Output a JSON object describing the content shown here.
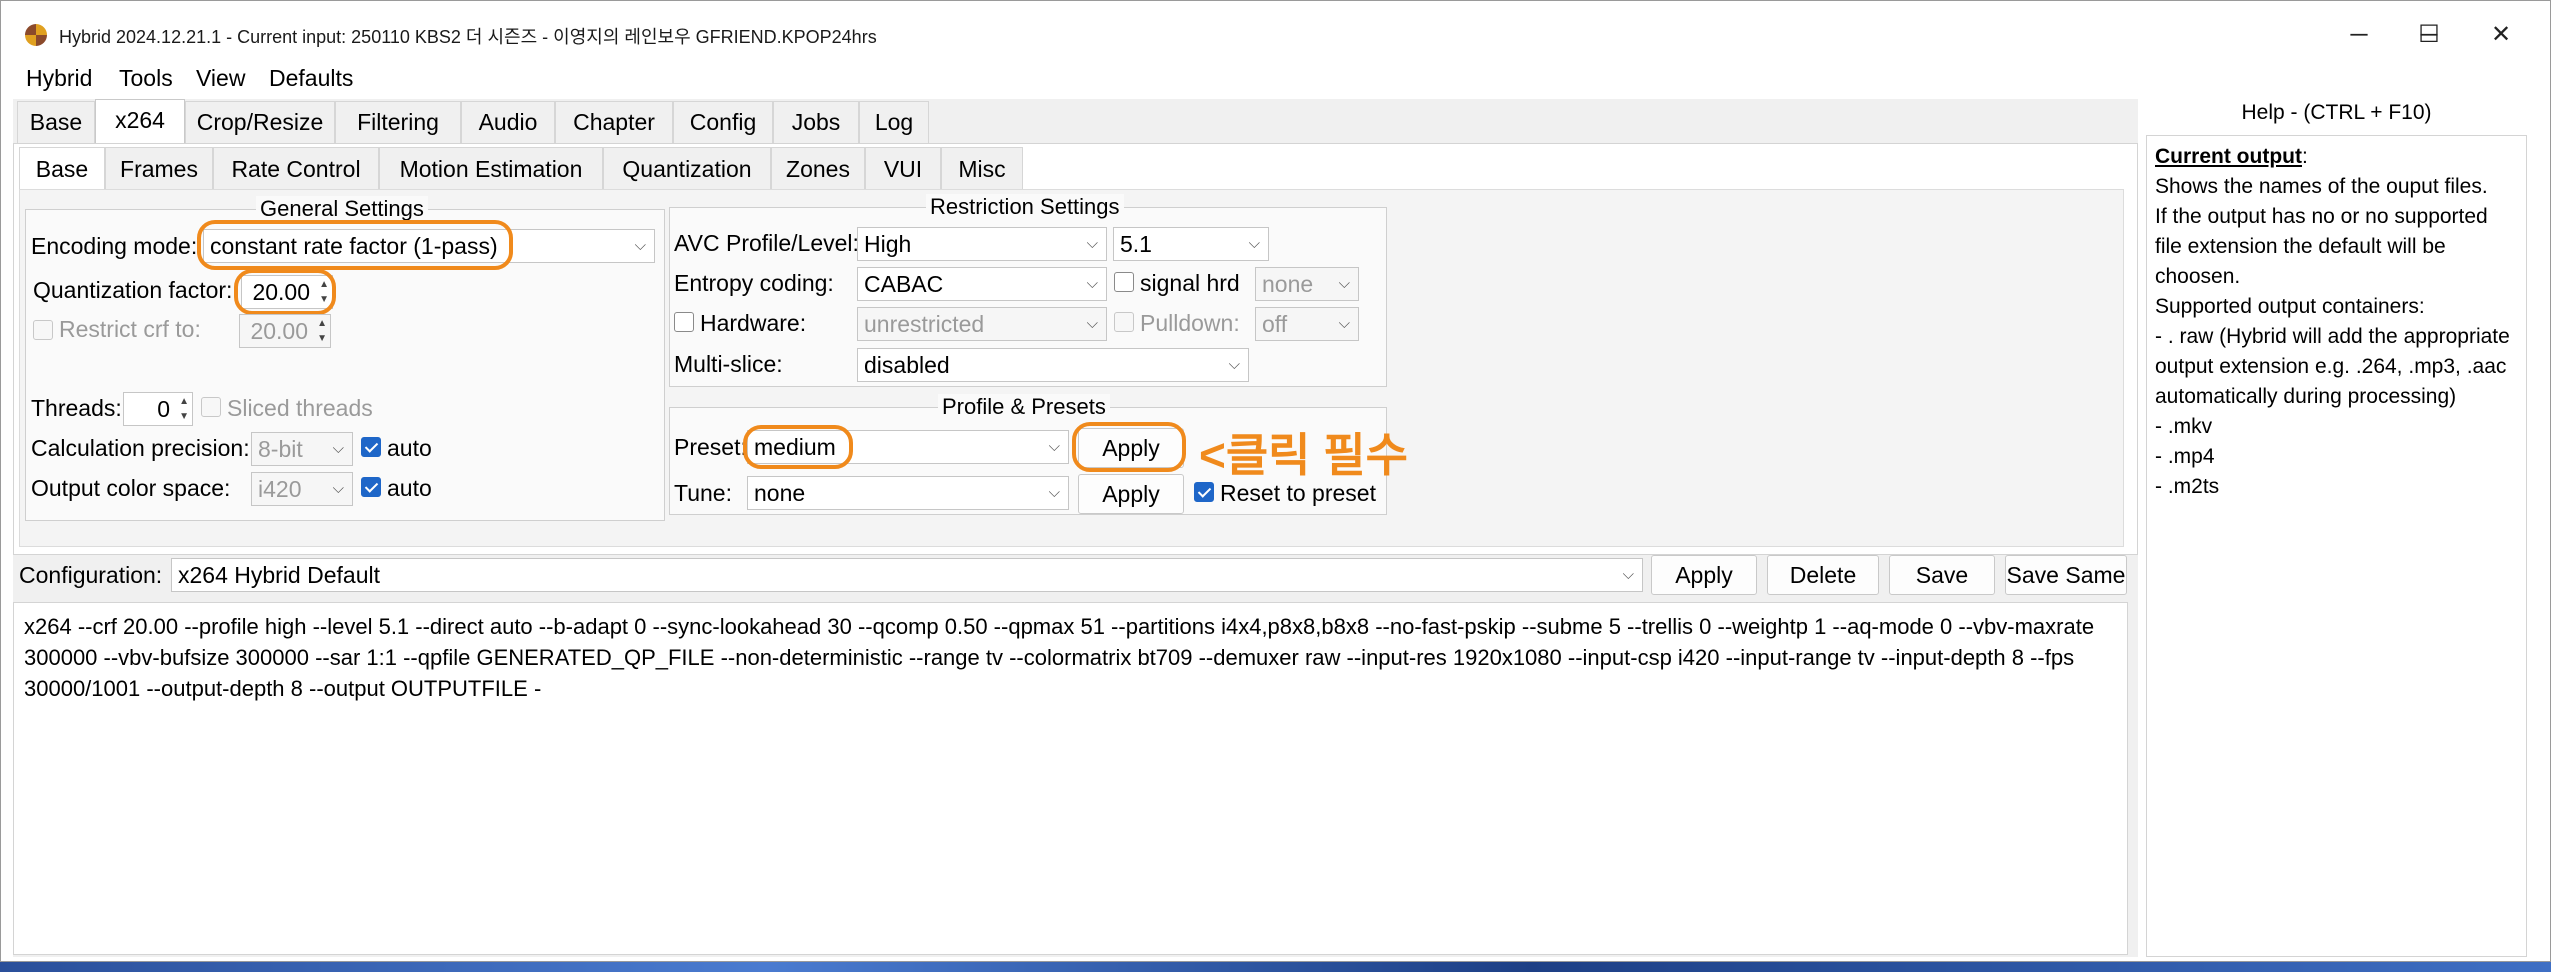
{
  "window": {
    "title": "Hybrid 2024.12.21.1 - Current input: 250110 KBS2 더 시즌즈 - 이영지의 레인보우 GFRIEND.KPOP24hrs",
    "minimize_glyph": "─",
    "maximize_glyph": "☐",
    "close_glyph": "✕"
  },
  "menubar": [
    "Hybrid",
    "Tools",
    "View",
    "Defaults"
  ],
  "main_tabs": [
    "Base",
    "x264",
    "Crop/Resize",
    "Filtering",
    "Audio",
    "Chapter",
    "Config",
    "Jobs",
    "Log"
  ],
  "sub_tabs": [
    "Base",
    "Frames",
    "Rate Control",
    "Motion Estimation",
    "Quantization",
    "Zones",
    "VUI",
    "Misc"
  ],
  "general": {
    "title": "General Settings",
    "encoding_mode_label": "Encoding mode:",
    "encoding_mode_value": "constant rate factor (1-pass)",
    "quant_label": "Quantization factor:",
    "quant_value": "20.00",
    "restrict_label": "Restrict crf to:",
    "restrict_value": "20.00",
    "threads_label": "Threads:",
    "threads_value": "0",
    "sliced_label": "Sliced threads",
    "calc_label": "Calculation precision:",
    "calc_value": "8-bit",
    "calc_auto": "auto",
    "colorspace_label": "Output color space:",
    "colorspace_value": "i420",
    "colorspace_auto": "auto"
  },
  "restriction": {
    "title": "Restriction Settings",
    "avc_label": "AVC Profile/Level:",
    "avc_profile": "High",
    "avc_level": "5.1",
    "entropy_label": "Entropy coding:",
    "entropy_value": "CABAC",
    "signal_hrd_label": "signal hrd",
    "signal_hrd_value": "none",
    "hardware_label": "Hardware:",
    "hardware_value": "unrestricted",
    "pulldown_label": "Pulldown:",
    "pulldown_value": "off",
    "multislice_label": "Multi-slice:",
    "multislice_value": "disabled"
  },
  "presets": {
    "title": "Profile & Presets",
    "preset_label": "Preset:",
    "preset_value": "medium",
    "apply_label": "Apply",
    "tune_label": "Tune:",
    "tune_value": "none",
    "apply2_label": "Apply",
    "reset_label": "Reset to preset"
  },
  "annotation": "<클릭 필수",
  "config": {
    "label": "Configuration:",
    "value": "x264 Hybrid Default",
    "apply": "Apply",
    "delete": "Delete",
    "save": "Save",
    "save_same": "Save Same"
  },
  "command_line": "x264 --crf 20.00 --profile high --level 5.1 --direct auto --b-adapt 0 --sync-lookahead 30 --qcomp 0.50 --qpmax 51 --partitions i4x4,p8x8,b8x8 --no-fast-pskip --subme 5 --trellis 0 --weightp 1 --aq-mode 0 --vbv-maxrate 300000 --vbv-bufsize 300000 --sar 1:1 --qpfile GENERATED_QP_FILE --non-deterministic --range tv --colormatrix bt709 --demuxer raw --input-res 1920x1080 --input-csp i420 --input-range tv --input-depth 8 --fps 30000/1001 --output-depth 8 --output OUTPUTFILE -",
  "help": {
    "title": "Help - (CTRL + F10)",
    "heading": "Current output",
    "colon": ":",
    "lines": [
      "Shows the names of the ouput files.",
      "If the output has no or no supported file extension the default will be choosen.",
      "Supported output containers:",
      "- . raw (Hybrid will add the appropriate output extension e.g. .264, .mp3, .aac automatically during processing)",
      "- .mkv",
      "- .mp4",
      "- .m2ts"
    ]
  },
  "accent_color": "#f08a1c",
  "check_color": "#1e66c8"
}
